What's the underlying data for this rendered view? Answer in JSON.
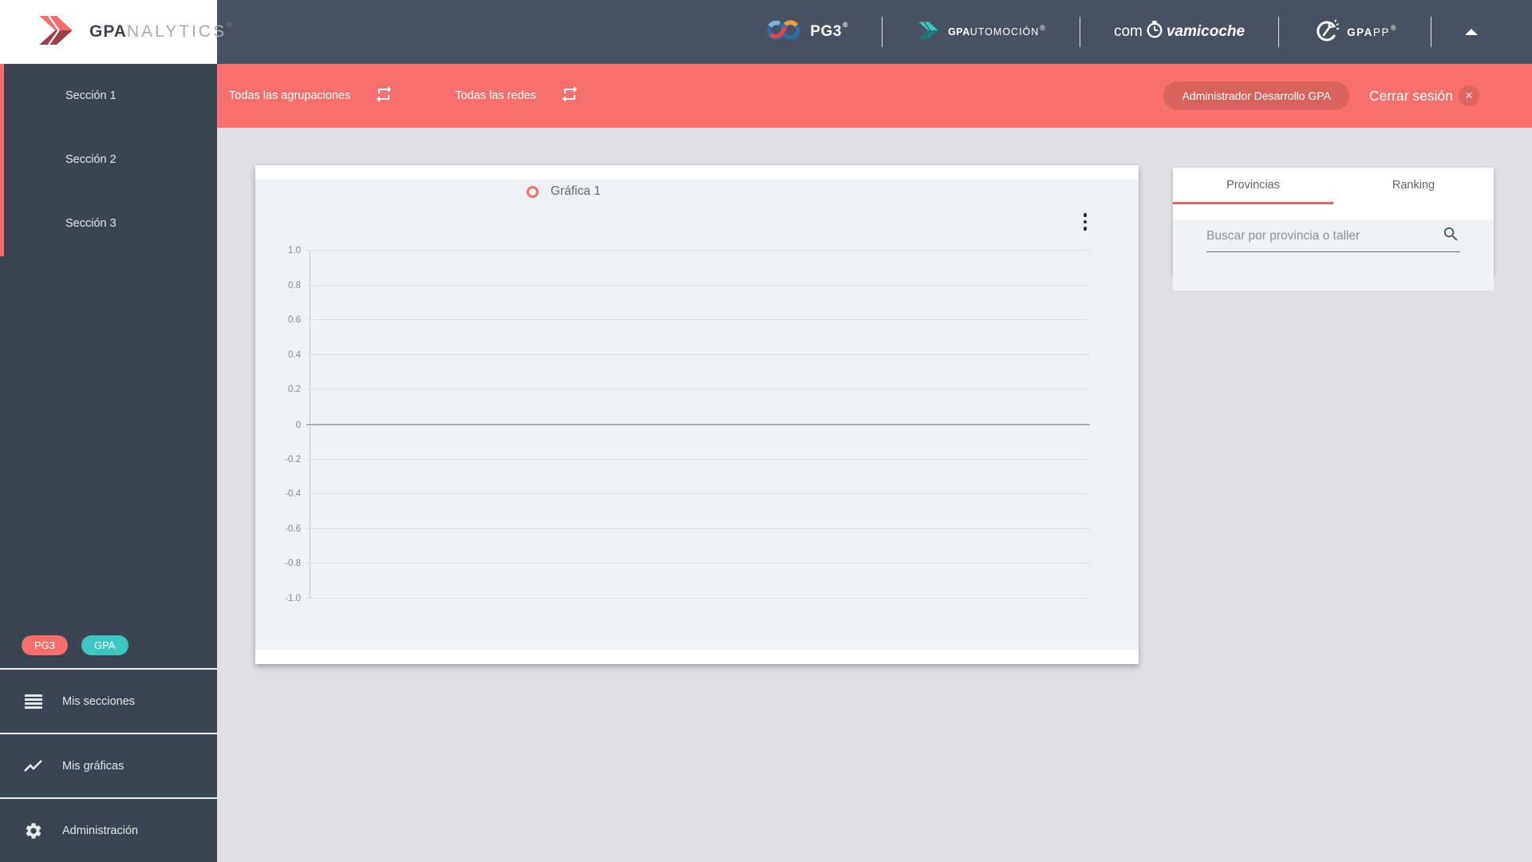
{
  "brand": {
    "bold": "GPA",
    "rest": "NALYTICS",
    "reg": "®"
  },
  "header": {
    "pg3": {
      "label": "PG3",
      "reg": "®"
    },
    "gpautomocion": {
      "bold": "GPA",
      "rest": "UTOMOCIÓN",
      "reg": "®"
    },
    "comprovamicoche": {
      "left": "com",
      "right": "vamicoche"
    },
    "gpapp": {
      "bold": "GPA",
      "rest": "PP",
      "reg": "®"
    }
  },
  "filterbar": {
    "select_agrupaciones": "Todas las agrupaciones",
    "select_redes": "Todas las redes",
    "user_chip": "Administrador Desarrollo GPA",
    "logout_label": "Cerrar sesión",
    "logout_icon": "✕"
  },
  "sidebar": {
    "sections": [
      "Sección 1",
      "Sección 2",
      "Sección 3"
    ],
    "badges": [
      {
        "label": "PG3",
        "color": "#F66D6B"
      },
      {
        "label": "GPA",
        "color": "#3EC6C0"
      }
    ],
    "menu": [
      {
        "label": "Mis secciones",
        "icon": "list-icon"
      },
      {
        "label": "Mis gráficas",
        "icon": "line-chart-icon"
      },
      {
        "label": "Administración",
        "icon": "gear-icon"
      }
    ]
  },
  "panel": {
    "tabs": [
      "Provincias",
      "Ranking"
    ],
    "active_tab": "Provincias",
    "search_placeholder": "Buscar por provincia o taller"
  },
  "chart_data": {
    "type": "line",
    "title": "Gráfica 1",
    "legend": [
      "Gráfica 1"
    ],
    "legend_position": "top-center",
    "series": [
      {
        "name": "Gráfica 1",
        "values": []
      }
    ],
    "x": [],
    "ylim": [
      -1,
      1
    ],
    "yticks": [
      1.0,
      0.8,
      0.6,
      0.4,
      0.2,
      0,
      -0.2,
      -0.4,
      -0.6,
      -0.8,
      -1.0
    ],
    "ytick_labels": [
      "1.0",
      "0.8",
      "0.6",
      "0.4",
      "0.2",
      "0",
      "-0.2",
      "-0.4",
      "-0.6",
      "-0.8",
      "-1.0"
    ],
    "grid": true,
    "series_color": "#F66D6B"
  },
  "colors": {
    "accent_red": "#F6706C",
    "teal": "#3EC6C0",
    "header_bg": "#485160",
    "sidebar_bg": "#3A4552",
    "page_bg": "#E0E0E3",
    "chart_bg": "#F0F1F3"
  }
}
